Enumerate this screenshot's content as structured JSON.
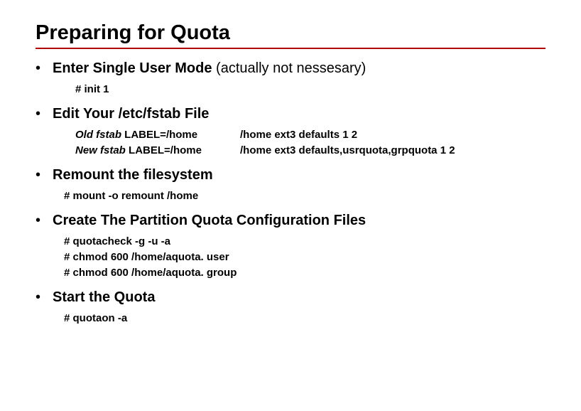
{
  "title": "Preparing for Quota",
  "bullets": [
    {
      "label_bold": "Enter Single User Mode",
      "label_rest": " (actually not nessesary)",
      "sub_plain": [
        "# init 1"
      ]
    },
    {
      "label_bold": "Edit Your /etc/fstab File",
      "label_rest": "",
      "fstab": [
        {
          "tag": "Old fstab",
          "left": "  LABEL=/home",
          "right": "/home ext3    defaults    1 2"
        },
        {
          "tag": "New fstab",
          "left": " LABEL=/home",
          "right": "/home ext3 defaults,usrquota,grpquota  1 2"
        }
      ]
    },
    {
      "label_bold": "Remount the filesystem",
      "label_rest": "",
      "sub_plain": [
        "# mount -o remount /home"
      ]
    },
    {
      "label_bold": "Create The Partition Quota Configuration Files",
      "label_rest": "",
      "sub_plain": [
        "# quotacheck -g -u -a",
        "# chmod 600 /home/aquota. user",
        "# chmod 600 /home/aquota. group"
      ]
    },
    {
      "label_bold": "Start the Quota",
      "label_rest": "",
      "sub_plain": [
        "# quotaon -a"
      ]
    }
  ]
}
